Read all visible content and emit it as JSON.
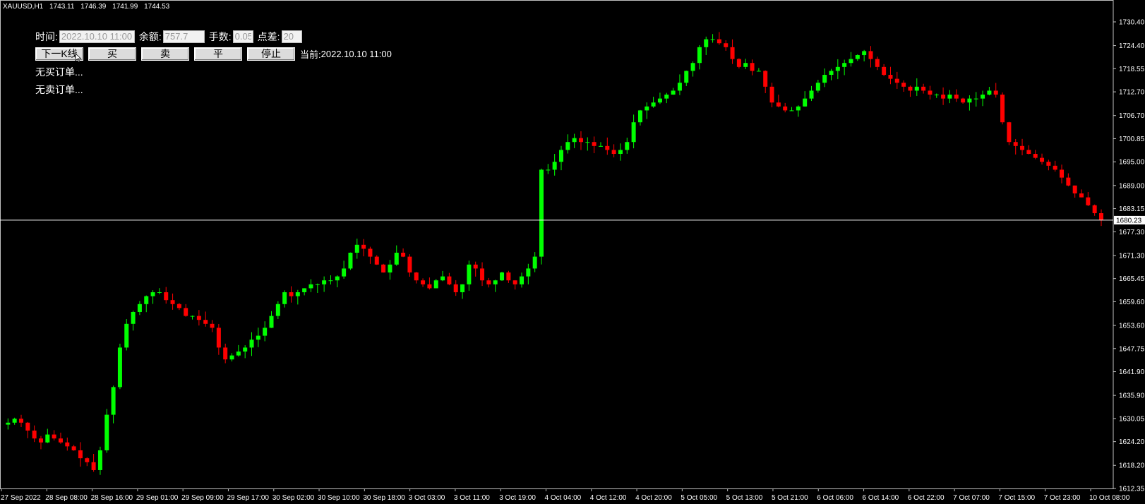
{
  "header": {
    "symbol": "XAUUSD,H1",
    "open": "1743.11",
    "high": "1746.39",
    "low": "1741.99",
    "close": "1744.53"
  },
  "panel": {
    "time_label": "时间:",
    "time_value": "2022.10.10 11:00",
    "balance_label": "余额:",
    "balance_value": "757.7",
    "lots_label": "手数:",
    "lots_value": "0.05",
    "spread_label": "点差:",
    "spread_value": "20",
    "buttons": {
      "next_bar": "下一K线",
      "buy": "买",
      "sell": "卖",
      "close": "平",
      "stop": "停止"
    },
    "current_label": "当前:",
    "current_value": "2022.10.10 11:00",
    "no_buy_orders": "无买订单...",
    "no_sell_orders": "无卖订单..."
  },
  "colors": {
    "background": "#000000",
    "bull": "#00ff00",
    "bear": "#ff0000",
    "grid_text": "#ffffff",
    "bid_line": "#ffffff"
  },
  "chart_data": {
    "type": "candlestick",
    "symbol": "XAUUSD",
    "timeframe": "H1",
    "price_axis": {
      "min": 1612.35,
      "max": 1733.0,
      "ticks": [
        "1730.40",
        "1724.40",
        "1718.55",
        "1712.70",
        "1706.70",
        "1700.85",
        "1695.00",
        "1689.00",
        "1683.15",
        "1677.30",
        "1671.30",
        "1665.45",
        "1659.60",
        "1653.60",
        "1647.75",
        "1641.90",
        "1635.90",
        "1630.05",
        "1624.20",
        "1618.20",
        "1612.35"
      ]
    },
    "time_axis_labels": [
      "27 Sep 2022",
      "28 Sep 08:00",
      "28 Sep 16:00",
      "29 Sep 01:00",
      "29 Sep 09:00",
      "29 Sep 17:00",
      "30 Sep 02:00",
      "30 Sep 10:00",
      "30 Sep 18:00",
      "3 Oct 03:00",
      "3 Oct 11:00",
      "3 Oct 19:00",
      "4 Oct 04:00",
      "4 Oct 12:00",
      "4 Oct 20:00",
      "5 Oct 05:00",
      "5 Oct 13:00",
      "5 Oct 21:00",
      "6 Oct 06:00",
      "6 Oct 14:00",
      "6 Oct 22:00",
      "7 Oct 07:00",
      "7 Oct 15:00",
      "7 Oct 23:00",
      "10 Oct 08:00"
    ],
    "current_price": "1680.23",
    "close_path": [
      1628.5,
      1629,
      1630,
      1629,
      1627,
      1625,
      1624,
      1626,
      1625,
      1624,
      1623,
      1622,
      1620,
      1619,
      1617,
      1622,
      1631,
      1638,
      1648,
      1654,
      1657,
      1659,
      1661,
      1662,
      1662,
      1660,
      1659,
      1658,
      1656,
      1656,
      1655,
      1654,
      1653,
      1648,
      1645,
      1646,
      1647,
      1648,
      1650,
      1651,
      1653,
      1656,
      1659,
      1662,
      1661,
      1662,
      1663,
      1664,
      1664,
      1665,
      1665,
      1666,
      1668,
      1672,
      1674,
      1673,
      1671,
      1669,
      1667,
      1669,
      1672,
      1671,
      1667,
      1665,
      1664,
      1663,
      1665,
      1666,
      1664,
      1662,
      1664,
      1669,
      1668,
      1665,
      1664,
      1665,
      1667,
      1665,
      1664,
      1666,
      1668,
      1671,
      1693,
      1693,
      1695,
      1698,
      1700,
      1701,
      1700,
      1700,
      1699,
      1699,
      1698,
      1697,
      1698,
      1700,
      1705,
      1708,
      1709,
      1710,
      1711,
      1712,
      1713,
      1715,
      1718,
      1720,
      1724,
      1726,
      1726,
      1725,
      1724,
      1721,
      1719,
      1720,
      1718,
      1718,
      1714,
      1710,
      1709,
      1708,
      1708,
      1709,
      1711,
      1713,
      1715,
      1717,
      1718,
      1719,
      1720,
      1721,
      1722,
      1723,
      1721,
      1719,
      1717,
      1716,
      1715,
      1714,
      1713,
      1714,
      1713,
      1712,
      1712,
      1711,
      1712,
      1711,
      1710,
      1711,
      1711,
      1712,
      1713,
      1712,
      1705,
      1700,
      1699,
      1698,
      1697,
      1696,
      1695,
      1694,
      1693,
      1691,
      1689,
      1687,
      1686,
      1684,
      1682,
      1680.23
    ]
  }
}
